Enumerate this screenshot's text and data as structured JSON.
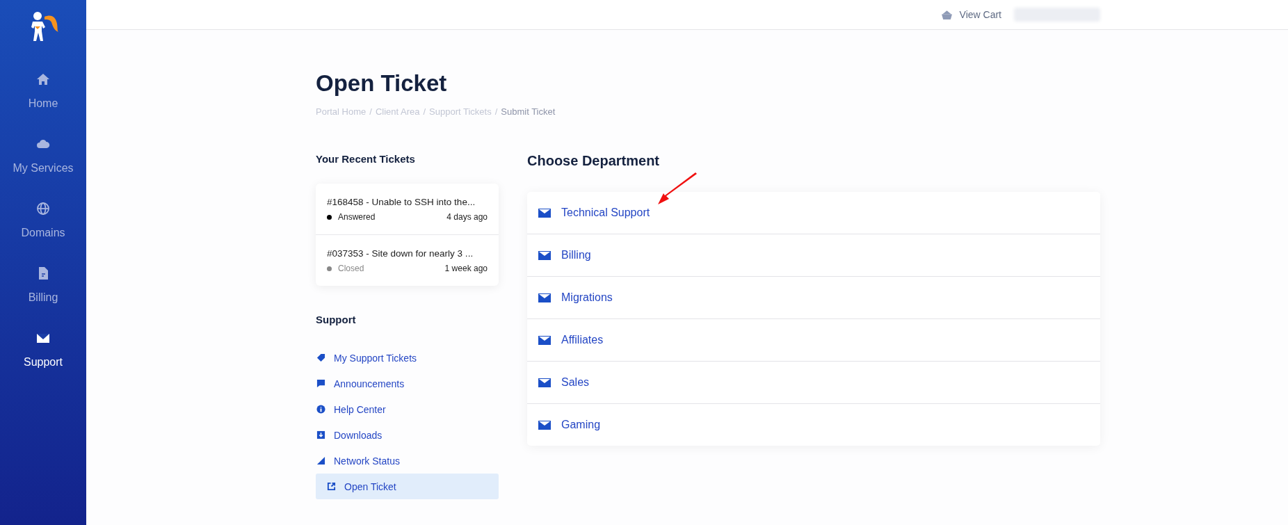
{
  "sidebar": {
    "items": [
      {
        "label": "Home",
        "kind": "home",
        "selected": false
      },
      {
        "label": "My Services",
        "kind": "cloud",
        "selected": false
      },
      {
        "label": "Domains",
        "kind": "globe",
        "selected": false
      },
      {
        "label": "Billing",
        "kind": "file",
        "selected": false
      },
      {
        "label": "Support",
        "kind": "mail",
        "selected": true
      }
    ]
  },
  "header": {
    "cart_label": "View Cart"
  },
  "page": {
    "title": "Open Ticket",
    "separator": "/",
    "breadcrumbs": [
      {
        "label": "Portal Home",
        "selected": false
      },
      {
        "label": "Client Area",
        "selected": false
      },
      {
        "label": "Support Tickets",
        "selected": false
      },
      {
        "label": "Submit Ticket",
        "selected": true
      }
    ]
  },
  "recent_tickets": {
    "heading": "Your Recent Tickets",
    "tickets": [
      {
        "title": "#168458 - Unable to SSH into the...",
        "status": "Answered",
        "color": "#000000",
        "time": "4 days ago"
      },
      {
        "title": "#037353 - Site down for nearly 3 ...",
        "status": "Closed",
        "color": "#888888",
        "time": "1 week ago"
      }
    ]
  },
  "support_menu": {
    "heading": "Support",
    "items": [
      {
        "label": "My Support Tickets",
        "kind": "tag",
        "selected": false
      },
      {
        "label": "Announcements",
        "kind": "comment",
        "selected": false
      },
      {
        "label": "Help Center",
        "kind": "info",
        "selected": false
      },
      {
        "label": "Downloads",
        "kind": "download",
        "selected": false
      },
      {
        "label": "Network Status",
        "kind": "signal",
        "selected": false
      },
      {
        "label": "Open Ticket",
        "kind": "external",
        "selected": true
      }
    ]
  },
  "departments": {
    "heading": "Choose Department",
    "items": [
      {
        "label": "Technical Support"
      },
      {
        "label": "Billing"
      },
      {
        "label": "Migrations"
      },
      {
        "label": "Affiliates"
      },
      {
        "label": "Sales"
      },
      {
        "label": "Gaming"
      }
    ]
  }
}
